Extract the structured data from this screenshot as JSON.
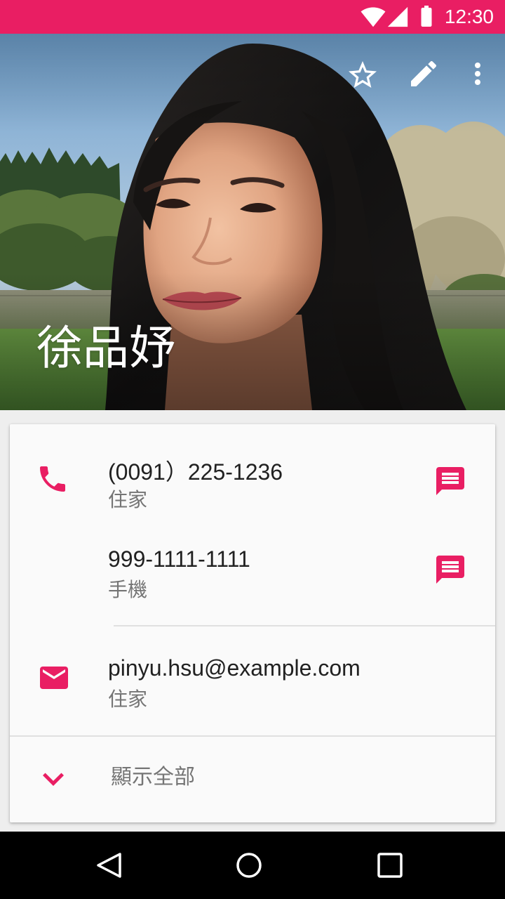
{
  "status_bar": {
    "time": "12:30",
    "icons": [
      "wifi-icon",
      "signal-icon",
      "battery-icon"
    ]
  },
  "header": {
    "contact_name": "徐品妤",
    "actions": [
      "star-icon",
      "edit-icon",
      "more-vert-icon"
    ]
  },
  "contact": {
    "phones": [
      {
        "number": "(0091）225-1236",
        "type": "住家",
        "action_icon": "message-icon"
      },
      {
        "number": "999-1111-1111",
        "type": "手機",
        "action_icon": "message-icon"
      }
    ],
    "emails": [
      {
        "address": "pinyu.hsu@example.com",
        "type": "住家"
      }
    ],
    "show_all_label": "顯示全部",
    "row_icons": [
      "phone-icon",
      "email-icon",
      "chevron-down-icon"
    ]
  },
  "nav_bar": {
    "icons": [
      "back-icon",
      "home-icon",
      "recents-icon"
    ]
  },
  "colors": {
    "accent": "#E91E63",
    "status_bar": "#E91E63",
    "primary_text": "#212121",
    "secondary_text": "#757575",
    "card_background": "#FAFAFA",
    "page_background": "#EEEEEE",
    "divider": "#E0E0E0",
    "nav_bar": "#000000"
  }
}
